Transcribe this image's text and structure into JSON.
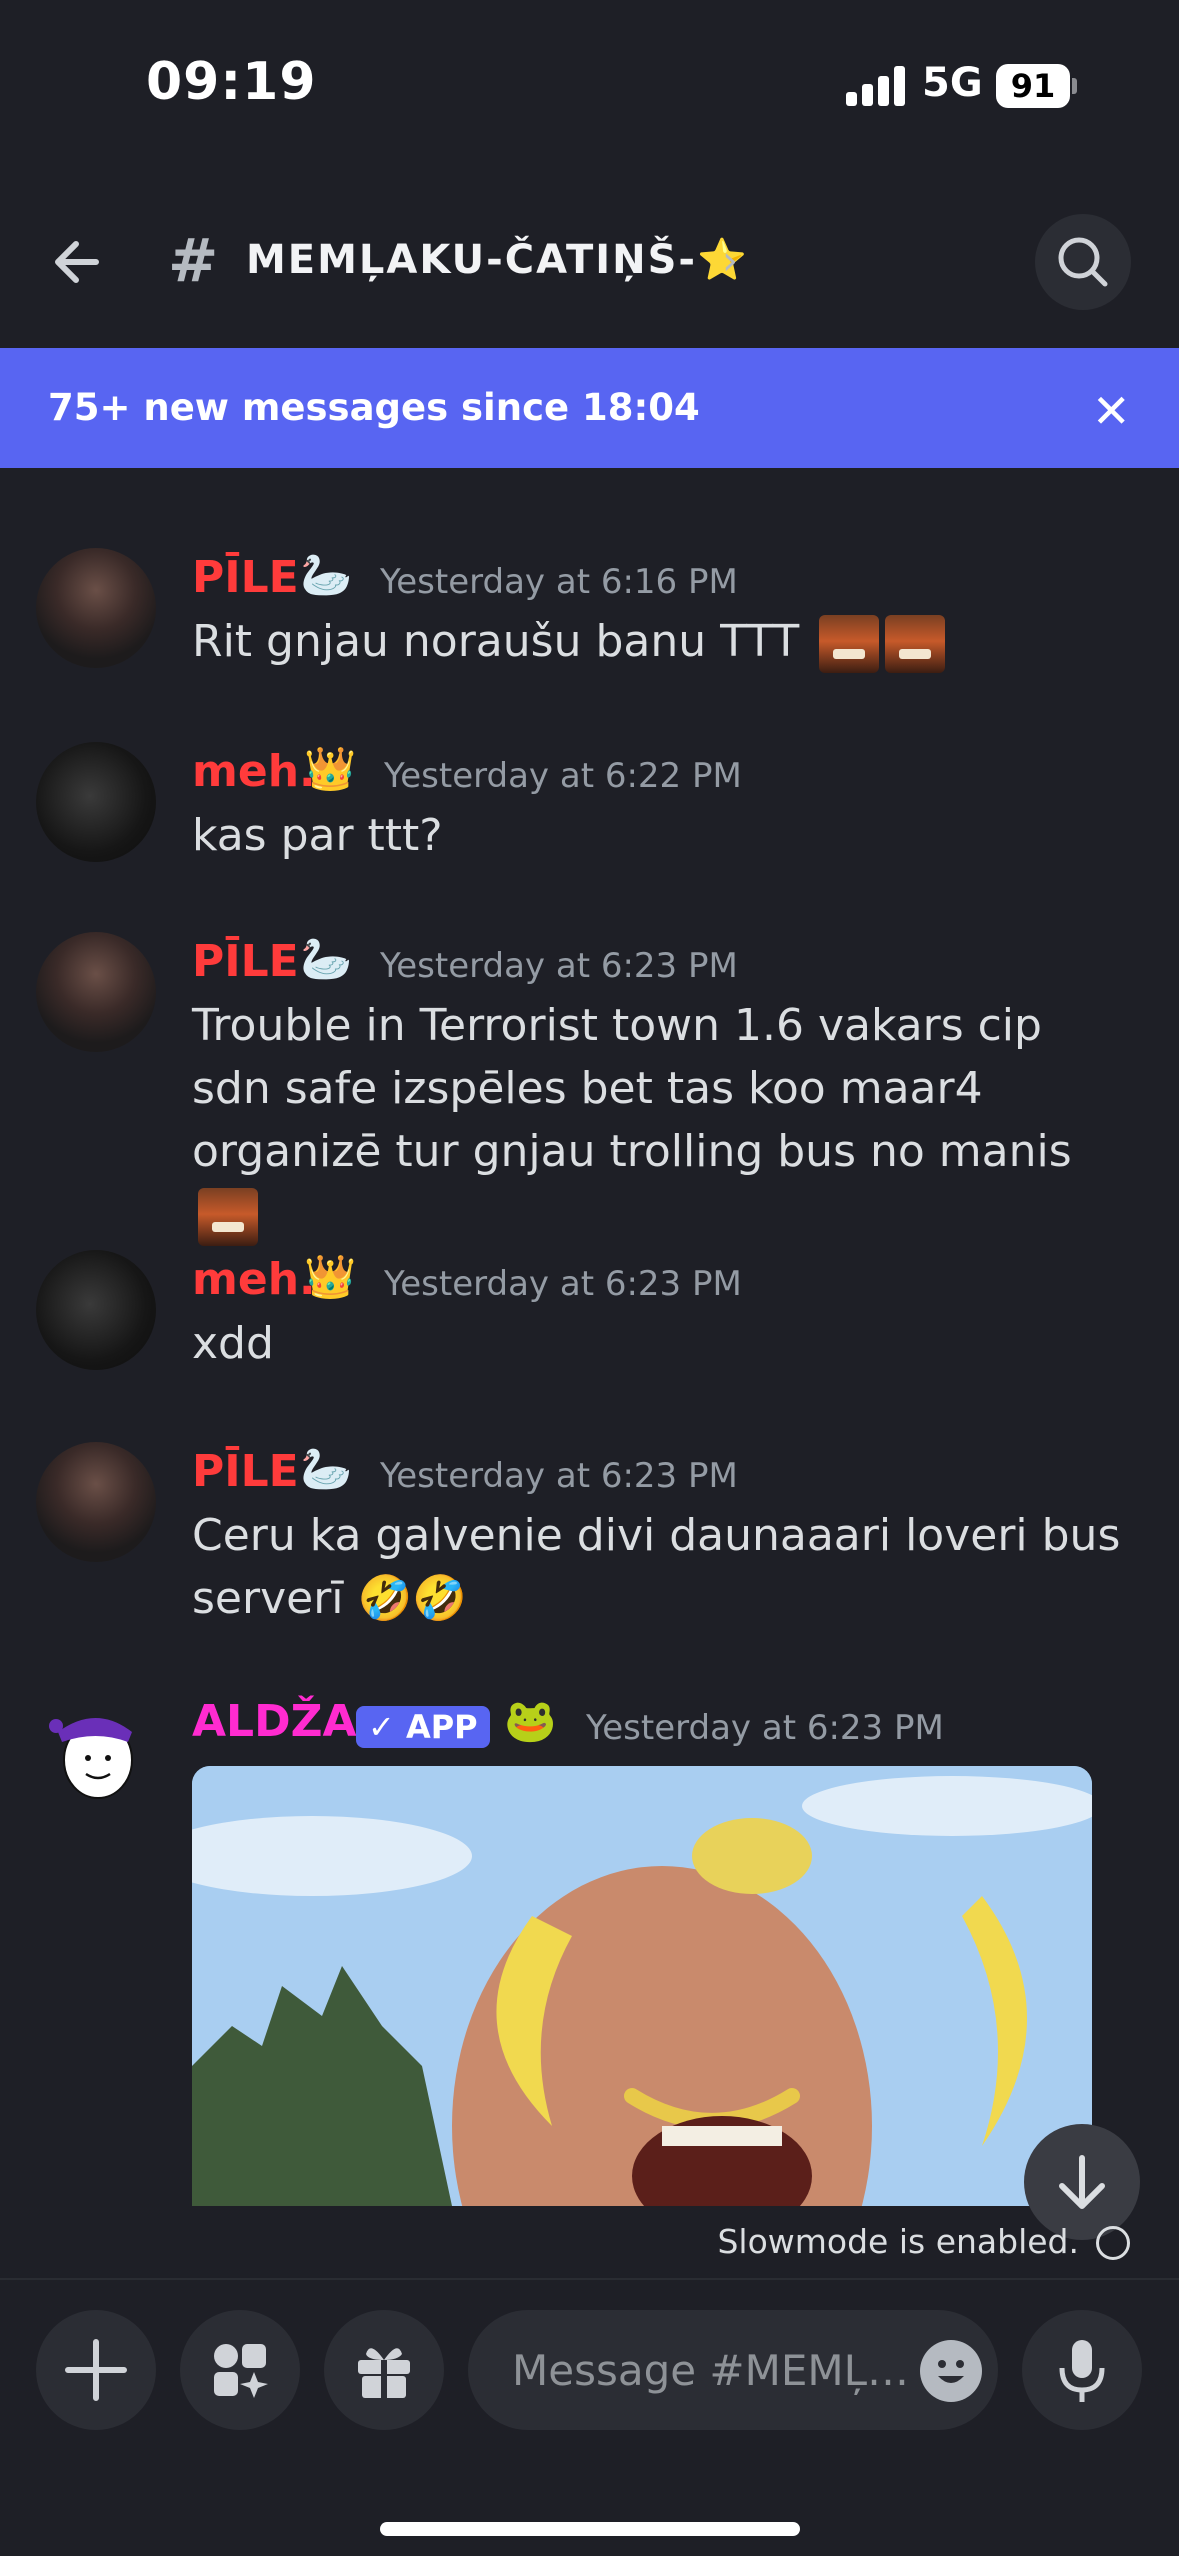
{
  "status_bar": {
    "time": "09:19",
    "network": "5G",
    "battery": "91"
  },
  "header": {
    "channel_name": "MEMĻAKU-ČATIŅŠ-⭐",
    "icons": [
      "back-arrow-icon",
      "hash-icon",
      "chevron-right-icon",
      "search-icon"
    ]
  },
  "banner": {
    "text": "75+ new messages since 18:04",
    "close": "✕",
    "color": "#5865f2"
  },
  "messages": [
    {
      "author": "PĪLE",
      "badge": "🦢",
      "time": "Yesterday at 6:16 PM",
      "text": "Rit gnjau noraušu banu TTT"
    },
    {
      "author": "meh.",
      "badge": "👑",
      "time": "Yesterday at 6:22 PM",
      "text": "kas par ttt?"
    },
    {
      "author": "PĪLE",
      "badge": "🦢",
      "time": "Yesterday at 6:23 PM",
      "text": "Trouble in Terrorist town 1.6 vakars cip sdn safe izspēles bet tas koo maar4 organizē tur gnjau trolling bus no manis"
    },
    {
      "author": "meh.",
      "badge": "👑",
      "time": "Yesterday at 6:23 PM",
      "text": "xdd"
    },
    {
      "author": "PĪLE",
      "badge": "🦢",
      "time": "Yesterday at 6:23 PM",
      "text": "Ceru ka galvenie divi daunaaari loveri bus serverī 🤣🤣"
    },
    {
      "author": "ALDŽA",
      "app_tag": "✓ APP",
      "badge": "🐸",
      "time": "Yesterday at 6:23 PM"
    }
  ],
  "slowmode": "Slowmode is enabled.",
  "composer": {
    "placeholder": "Message #MEMĻ…"
  },
  "colors": {
    "background": "#1e1f26",
    "accent": "#5865f2",
    "author_red": "#ff3b3b",
    "author_pink": "#ff2bd0"
  }
}
